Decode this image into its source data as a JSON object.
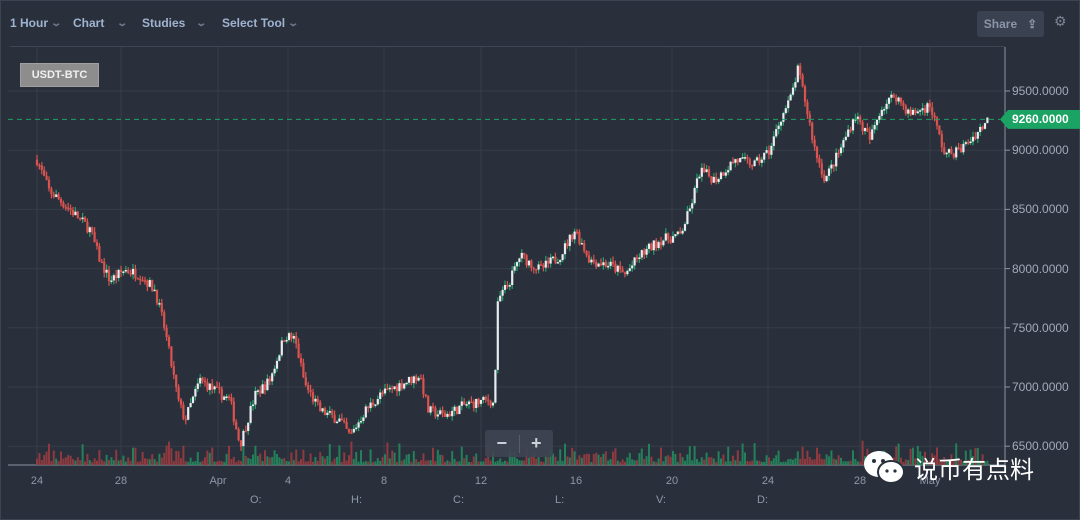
{
  "toolbar": {
    "interval": "1 Hour",
    "chart": "Chart",
    "studies": "Studies",
    "select_tool": "Select Tool",
    "share": "Share"
  },
  "symbol": "USDT-BTC",
  "current_price": "9260.0000",
  "zoom": {
    "minus": "−",
    "plus": "+"
  },
  "ohlc_labels": [
    "O:",
    "H:",
    "C:",
    "L:",
    "V:",
    "D:"
  ],
  "watermark": "说币有点料",
  "colors": {
    "up": "#26a16b",
    "down": "#d9534f",
    "candle_body": "#e8ecf0",
    "current": "#1aa362",
    "background": "#2a303b"
  },
  "chart_data": {
    "type": "candlestick",
    "title": "",
    "x_tick_labels": [
      "24",
      "28",
      "Apr",
      "4",
      "8",
      "12",
      "16",
      "20",
      "24",
      "28",
      "May"
    ],
    "y_tick_labels": [
      "9500.0000",
      "9000.0000",
      "8500.0000",
      "8000.0000",
      "7500.0000",
      "7000.0000",
      "6500.0000"
    ],
    "ylim": [
      6500,
      9500
    ],
    "grid": true,
    "close_series": [
      [
        "03-24 12",
        8920
      ],
      [
        "03-25 00",
        8660
      ],
      [
        "03-25 21",
        8500
      ],
      [
        "03-26 17",
        8330
      ],
      [
        "03-27 03",
        8070
      ],
      [
        "03-27 13",
        7900
      ],
      [
        "03-28 04",
        7990
      ],
      [
        "03-28 19",
        7950
      ],
      [
        "03-29 10",
        7820
      ],
      [
        "03-29 20",
        7480
      ],
      [
        "03-30 09",
        6890
      ],
      [
        "03-30 16",
        6720
      ],
      [
        "03-31 07",
        7060
      ],
      [
        "03-31 22",
        6970
      ],
      [
        "04-01 13",
        6890
      ],
      [
        "04-01 23",
        6510
      ],
      [
        "04-02 14",
        6930
      ],
      [
        "04-03 05",
        7060
      ],
      [
        "04-03 20",
        7440
      ],
      [
        "04-04 06",
        7400
      ],
      [
        "04-04 16",
        7020
      ],
      [
        "04-05 07",
        6800
      ],
      [
        "04-06 03",
        6720
      ],
      [
        "04-06 13",
        6580
      ],
      [
        "04-07 04",
        6800
      ],
      [
        "04-07 19",
        6930
      ],
      [
        "04-08 15",
        7020
      ],
      [
        "04-09 11",
        7100
      ],
      [
        "04-09 19",
        6800
      ],
      [
        "04-10 12",
        6760
      ],
      [
        "04-11 08",
        6850
      ],
      [
        "04-12 09",
        6890
      ],
      [
        "04-12 13",
        6850
      ],
      [
        "04-12 17",
        7730
      ],
      [
        "04-13 05",
        7900
      ],
      [
        "04-13 15",
        8110
      ],
      [
        "04-14 11",
        7990
      ],
      [
        "04-15 07",
        8110
      ],
      [
        "04-15 22",
        8330
      ],
      [
        "04-16 13",
        8070
      ],
      [
        "04-17 09",
        8030
      ],
      [
        "04-18 00",
        7950
      ],
      [
        "04-18 15",
        8110
      ],
      [
        "04-19 11",
        8240
      ],
      [
        "04-20 07",
        8280
      ],
      [
        "04-20 17",
        8500
      ],
      [
        "04-21 03",
        8830
      ],
      [
        "04-21 18",
        8750
      ],
      [
        "04-22 14",
        8920
      ],
      [
        "04-23 10",
        8880
      ],
      [
        "04-24 01",
        9000
      ],
      [
        "04-24 11",
        9260
      ],
      [
        "04-24 21",
        9420
      ],
      [
        "04-25 05",
        9680
      ],
      [
        "04-25 12",
        9420
      ],
      [
        "04-25 22",
        9000
      ],
      [
        "04-26 08",
        8750
      ],
      [
        "04-26 23",
        9000
      ],
      [
        "04-27 14",
        9300
      ],
      [
        "04-28 05",
        9090
      ],
      [
        "04-28 15",
        9340
      ],
      [
        "04-29 06",
        9470
      ],
      [
        "04-29 21",
        9300
      ],
      [
        "04-30 17",
        9380
      ],
      [
        "05-01 08",
        8960
      ],
      [
        "05-01 23",
        9000
      ],
      [
        "05-02 14",
        9130
      ],
      [
        "05-03 03",
        9260
      ]
    ]
  }
}
